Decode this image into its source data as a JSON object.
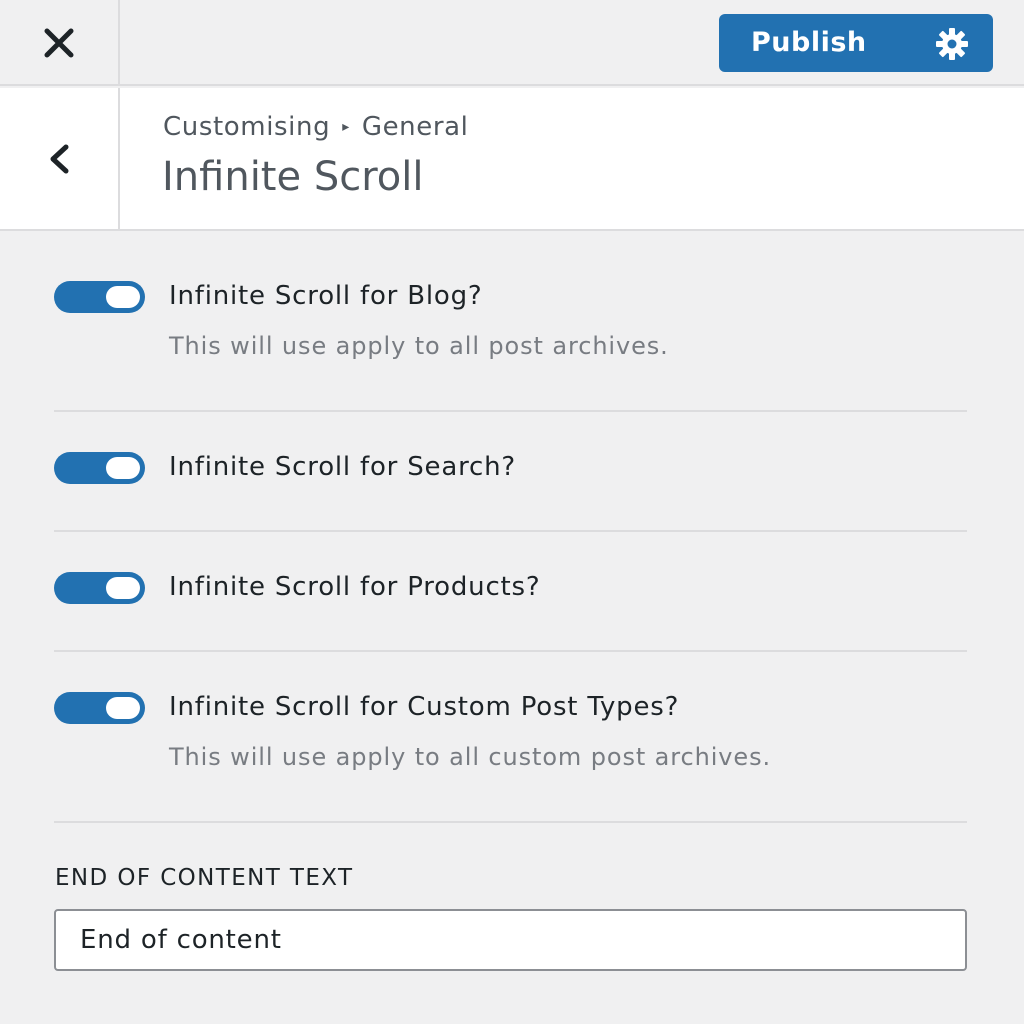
{
  "topbar": {
    "close_icon": "close-icon",
    "publish_label": "Publish",
    "publish_icon": "gear-icon",
    "accent": "#2271b1"
  },
  "header": {
    "back_icon": "chevron-left-icon",
    "breadcrumb": [
      "Customising",
      "General"
    ],
    "title": "Infinite Scroll"
  },
  "settings": [
    {
      "label": "Infinite Scroll for Blog?",
      "description": "This will use apply to all post archives.",
      "enabled": true
    },
    {
      "label": "Infinite Scroll for Search?",
      "description": "",
      "enabled": true
    },
    {
      "label": "Infinite Scroll for Products?",
      "description": "",
      "enabled": true
    },
    {
      "label": "Infinite Scroll for Custom Post Types?",
      "description": "This will use apply to all custom post archives.",
      "enabled": true
    }
  ],
  "end_text": {
    "label": "END OF CONTENT TEXT",
    "value": "End of content"
  }
}
